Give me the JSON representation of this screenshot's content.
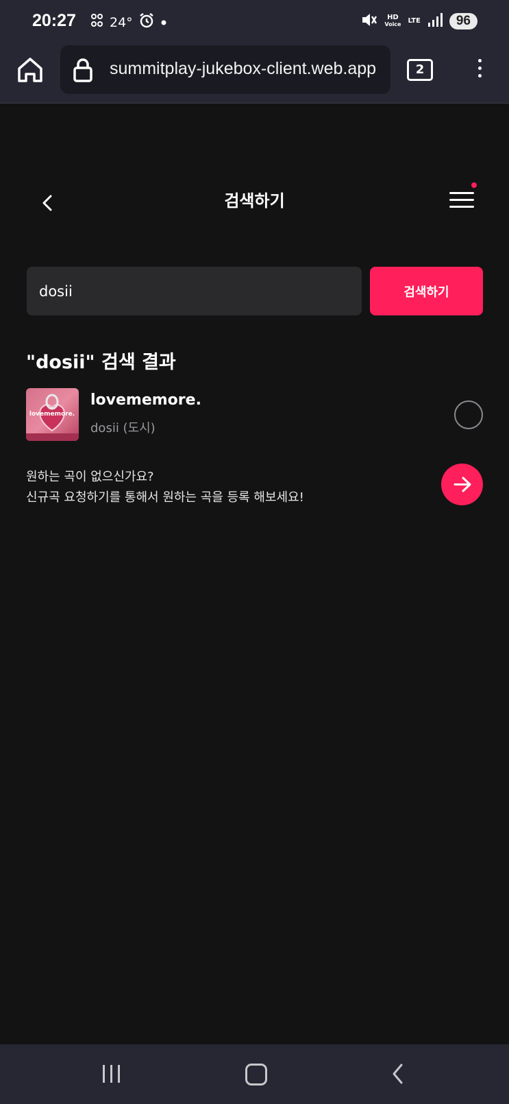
{
  "status": {
    "time": "20:27",
    "temperature": "24°",
    "battery": "96",
    "network": "LTE",
    "hd_voice_top": "HD",
    "hd_voice_bottom": "Voice"
  },
  "browser": {
    "url": "summitplay-jukebox-client.web.app",
    "tab_count": "2"
  },
  "header": {
    "title": "검색하기"
  },
  "search": {
    "value": "dosii",
    "button_label": "검색하기"
  },
  "results": {
    "heading": "\"dosii\" 검색 결과",
    "items": [
      {
        "title": "lovememore.",
        "artist": "dosii (도시)",
        "album_text": "lovememore."
      }
    ]
  },
  "request": {
    "line1": "원하는 곡이 없으신가요?",
    "line2": "신규곡 요청하기를 통해서 원하는 곡을 등록 해보세요!"
  },
  "colors": {
    "accent": "#ff1f5a",
    "background": "#131314",
    "system_bar": "#272633"
  },
  "icons": {
    "home": "home-icon",
    "lock": "lock-icon",
    "back": "chevron-left-icon",
    "menu": "hamburger-menu-icon",
    "arrow": "arrow-right-icon"
  }
}
